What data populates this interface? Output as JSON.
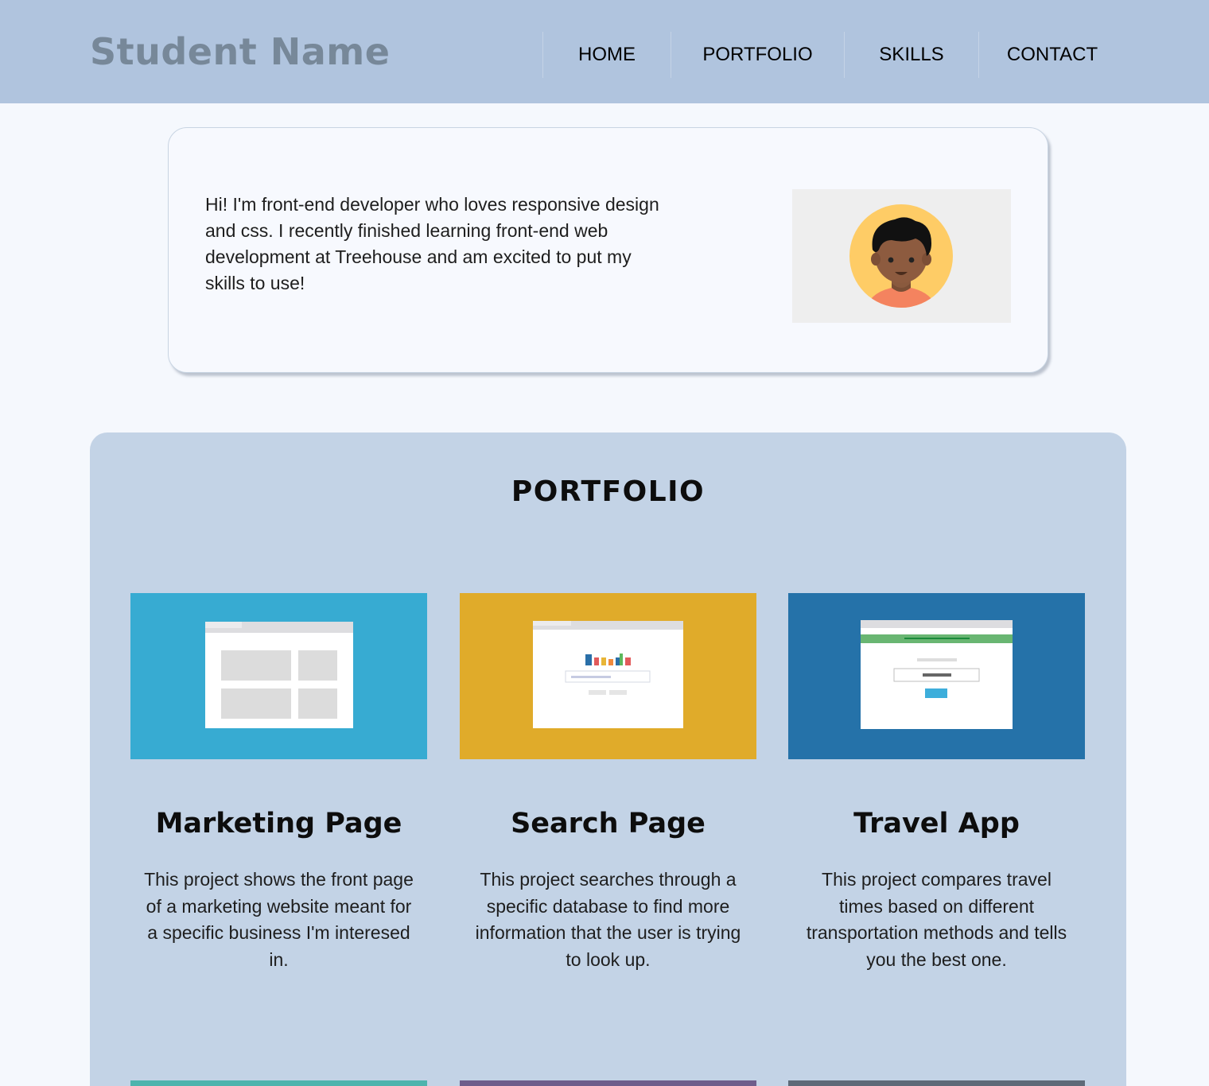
{
  "header": {
    "brand": "Student Name",
    "nav": [
      "HOME",
      "PORTFOLIO",
      "SKILLS",
      "CONTACT"
    ]
  },
  "intro": {
    "text": "Hi! I'm front-end developer who loves responsive design and css. I recently finished learning front-end web development at Treehouse and am excited to put my skills to use!",
    "avatar_icon": "avatar-illustration"
  },
  "portfolio": {
    "title": "PORTFOLIO",
    "projects": [
      {
        "title": "Marketing Page",
        "description": "This project shows the front page of a marketing website meant for a specific business I'm interesed in.",
        "color": "#37abd2"
      },
      {
        "title": "Search Page",
        "description": "This project searches through a specific database to find more information that the user is trying to look up.",
        "color": "#e0ab2a"
      },
      {
        "title": "Travel App",
        "description": "This project compares travel times based on different transportation methods and tells you the best one.",
        "color": "#2572a9"
      }
    ],
    "next_row_colors": [
      "#4db4ad",
      "#6e5d8b",
      "#5e6a78"
    ]
  },
  "colors": {
    "header_bg": "#b0c4de",
    "brand": "#778899",
    "page_bg": "#f5f8fd",
    "panel_bg": "#c3d3e6"
  }
}
